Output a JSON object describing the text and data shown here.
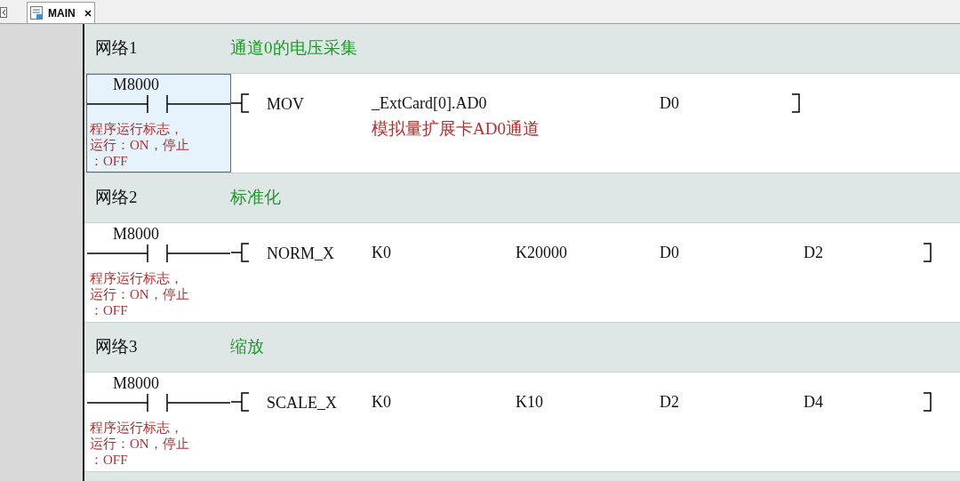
{
  "tabs": [
    {
      "label": "MAIN",
      "selected": true
    }
  ],
  "networks": [
    {
      "title": "网络1",
      "comment": "通道0的电压采集",
      "contact": {
        "address": "M8000",
        "comment": "程序运行标志，运行：ON，停止：OFF",
        "selected": true
      },
      "instruction": "MOV",
      "operands": [
        {
          "text": "_ExtCard[0].AD0",
          "comment": "模拟量扩展卡AD0通道"
        },
        {
          "text": "D0"
        }
      ]
    },
    {
      "title": "网络2",
      "comment": "标准化",
      "contact": {
        "address": "M8000",
        "comment": "程序运行标志，运行：ON，停止：OFF",
        "selected": false
      },
      "instruction": "NORM_X",
      "operands": [
        {
          "text": "K0"
        },
        {
          "text": "K20000"
        },
        {
          "text": "D0"
        },
        {
          "text": "D2"
        }
      ]
    },
    {
      "title": "网络3",
      "comment": "缩放",
      "contact": {
        "address": "M8000",
        "comment": "程序运行标志，运行：ON，停止：OFF",
        "selected": false
      },
      "instruction": "SCALE_X",
      "operands": [
        {
          "text": "K0"
        },
        {
          "text": "K10"
        },
        {
          "text": "D2"
        },
        {
          "text": "D4"
        }
      ]
    }
  ]
}
